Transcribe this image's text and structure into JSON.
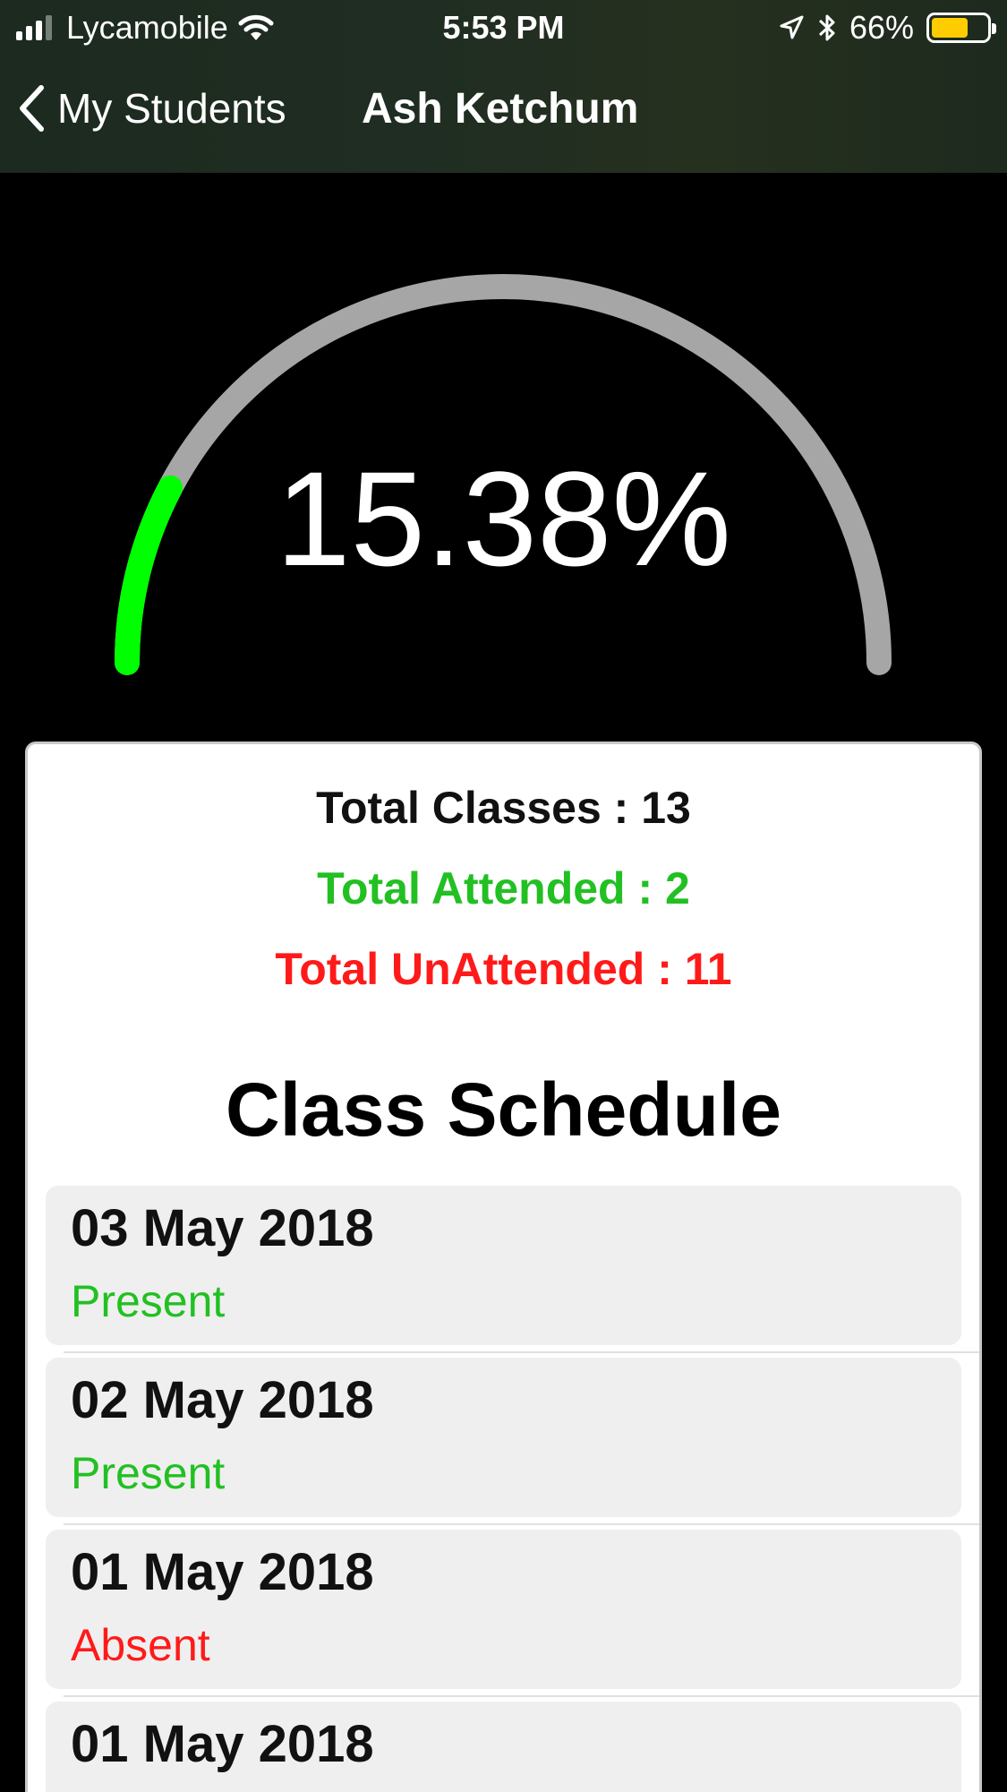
{
  "status_bar": {
    "carrier": "Lycamobile",
    "time": "5:53 PM",
    "battery": "66%",
    "battery_fraction": 0.66,
    "icons": [
      "signal-icon",
      "wifi-icon",
      "location-icon",
      "bluetooth-icon",
      "battery-icon"
    ]
  },
  "nav": {
    "back_label": "My Students",
    "title": "Ash Ketchum"
  },
  "gauge": {
    "percent_text": "15.38%",
    "fraction": 0.1538,
    "fill_color": "#00ff00",
    "track_color": "#a6a6a6"
  },
  "stats": {
    "total": "Total Classes : 13",
    "attended": "Total Attended : 2",
    "unattended": "Total UnAttended : 11"
  },
  "schedule": {
    "title": "Class Schedule",
    "items": [
      {
        "date": "03 May 2018",
        "status": "Present"
      },
      {
        "date": "02 May 2018",
        "status": "Present"
      },
      {
        "date": "01 May 2018",
        "status": "Absent"
      },
      {
        "date": "01 May 2018",
        "status": ""
      }
    ]
  },
  "colors": {
    "present": "#22c022",
    "absent": "#ff1a1a"
  }
}
